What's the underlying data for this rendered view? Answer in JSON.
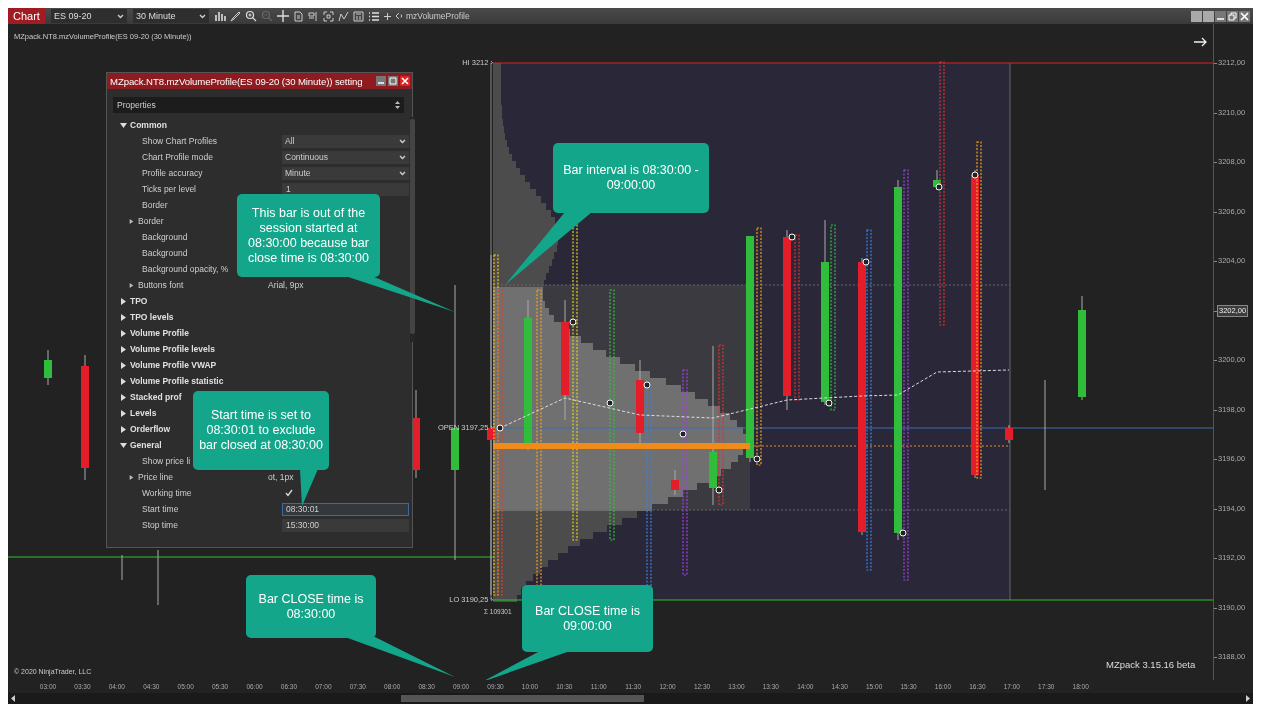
{
  "window": {
    "tab": "Chart",
    "instrument": "ES 09-20",
    "interval": "30 Minute",
    "indicator_button": "mzVolumeProfile"
  },
  "indicator_label": "MZpack.NT8.mzVolumeProfile(ES 09-20 (30 Minute))",
  "chart_labels": {
    "high": "HI 3212 ›",
    "open": "OPEN 3197,25 ›",
    "low": "LO 3190,25 ›",
    "volume": "Σ 109301"
  },
  "copyright": "© 2020 NinjaTrader, LLC",
  "version": "MZpack 3.15.16 beta",
  "price_axis": [
    {
      "text": "3212,00",
      "current": false
    },
    {
      "text": "3210,00",
      "current": false
    },
    {
      "text": "3208,00",
      "current": false
    },
    {
      "text": "3206,00",
      "current": false
    },
    {
      "text": "3204,00",
      "current": false
    },
    {
      "text": "3202,00",
      "current": true
    },
    {
      "text": "3200,00",
      "current": false
    },
    {
      "text": "3198,00",
      "current": false
    },
    {
      "text": "3196,00",
      "current": false
    },
    {
      "text": "3194,00",
      "current": false
    },
    {
      "text": "3192,00",
      "current": false
    },
    {
      "text": "3190,00",
      "current": false
    },
    {
      "text": "3188,00",
      "current": false
    }
  ],
  "time_axis": [
    "03:00",
    "03:30",
    "04:00",
    "04:30",
    "05:00",
    "05:30",
    "06:00",
    "06:30",
    "07:00",
    "07:30",
    "08:00",
    "08:30",
    "09:00",
    "09:30",
    "10:00",
    "10:30",
    "11:00",
    "11:30",
    "12:00",
    "12:30",
    "13:00",
    "13:30",
    "14:00",
    "14:30",
    "15:00",
    "15:30",
    "16:00",
    "16:30",
    "17:00",
    "17:30",
    "18:00"
  ],
  "settings_dialog": {
    "title": "MZpack.NT8.mzVolumeProfile(ES 09-20 (30 Minute)) setting",
    "header": "Properties",
    "rows": [
      {
        "kind": "category",
        "label": "Common",
        "expanded": true
      },
      {
        "kind": "dropdown",
        "label": "Show Chart Profiles",
        "value": "All"
      },
      {
        "kind": "dropdown",
        "label": "Chart Profile mode",
        "value": "Continuous"
      },
      {
        "kind": "dropdown",
        "label": "Profile accuracy",
        "value": "Minute"
      },
      {
        "kind": "field",
        "label": "Ticks per level",
        "value": "1",
        "focused": false
      },
      {
        "kind": "plain",
        "label": "Border"
      },
      {
        "kind": "group",
        "label": "Border",
        "expanded": false
      },
      {
        "kind": "plain",
        "label": "Background"
      },
      {
        "kind": "plain",
        "label": "Background"
      },
      {
        "kind": "plain",
        "label": "Background opacity, %"
      },
      {
        "kind": "group",
        "label": "Buttons font",
        "value": "Arial, 9px",
        "expanded": false
      },
      {
        "kind": "category",
        "label": "TPO",
        "expanded": false
      },
      {
        "kind": "category",
        "label": "TPO levels",
        "expanded": false
      },
      {
        "kind": "category",
        "label": "Volume Profile",
        "expanded": false
      },
      {
        "kind": "category",
        "label": "Volume Profile levels",
        "expanded": false
      },
      {
        "kind": "category",
        "label": "Volume Profile VWAP",
        "expanded": false
      },
      {
        "kind": "category",
        "label": "Volume Profile statistic",
        "expanded": false
      },
      {
        "kind": "category",
        "label": "Stacked prof",
        "expanded": false
      },
      {
        "kind": "category",
        "label": "Levels",
        "expanded": false
      },
      {
        "kind": "category",
        "label": "Orderflow",
        "expanded": false
      },
      {
        "kind": "category",
        "label": "General",
        "expanded": true
      },
      {
        "kind": "plain",
        "label": "Show price li"
      },
      {
        "kind": "group",
        "label": "Price line",
        "value": "ot, 1px",
        "expanded": false
      },
      {
        "kind": "checkbox",
        "label": "Working time",
        "checked": true
      },
      {
        "kind": "field",
        "label": "Start time",
        "value": "08:30:01",
        "focused": true
      },
      {
        "kind": "field",
        "label": "Stop time",
        "value": "15:30:00",
        "focused": false
      }
    ]
  },
  "callouts": [
    {
      "text": "This bar is out of the session started at 08:30:00 because bar close time is 08:30:00"
    },
    {
      "text": "Bar interval is 08:30:00 - 09:00:00"
    },
    {
      "text": "Start time is set to 08:30:01 to exclude bar closed at 08:30:00"
    },
    {
      "text": "Bar CLOSE time is 08:30:00"
    },
    {
      "text": "Bar CLOSE time is 09:00:00"
    }
  ]
}
